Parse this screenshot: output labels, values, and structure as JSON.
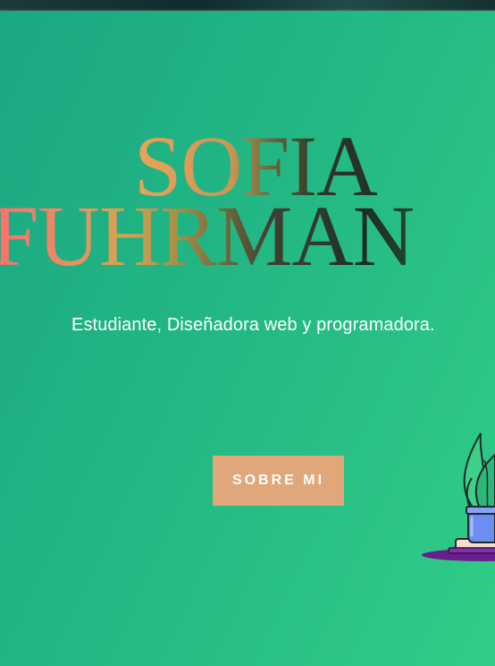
{
  "hero": {
    "name_line1": "SOFIA",
    "name_line2": "FUHRMAN",
    "subtitle": "Estudiante, Diseñadora web y programadora."
  },
  "cta": {
    "label": "SOBRE MI"
  },
  "colors": {
    "background_start": "#1aa882",
    "background_end": "#31cd86",
    "button": "#e0a77a",
    "subtitle_text": "#ffffff"
  },
  "illustration": {
    "icon": "plant-pot-icon"
  }
}
